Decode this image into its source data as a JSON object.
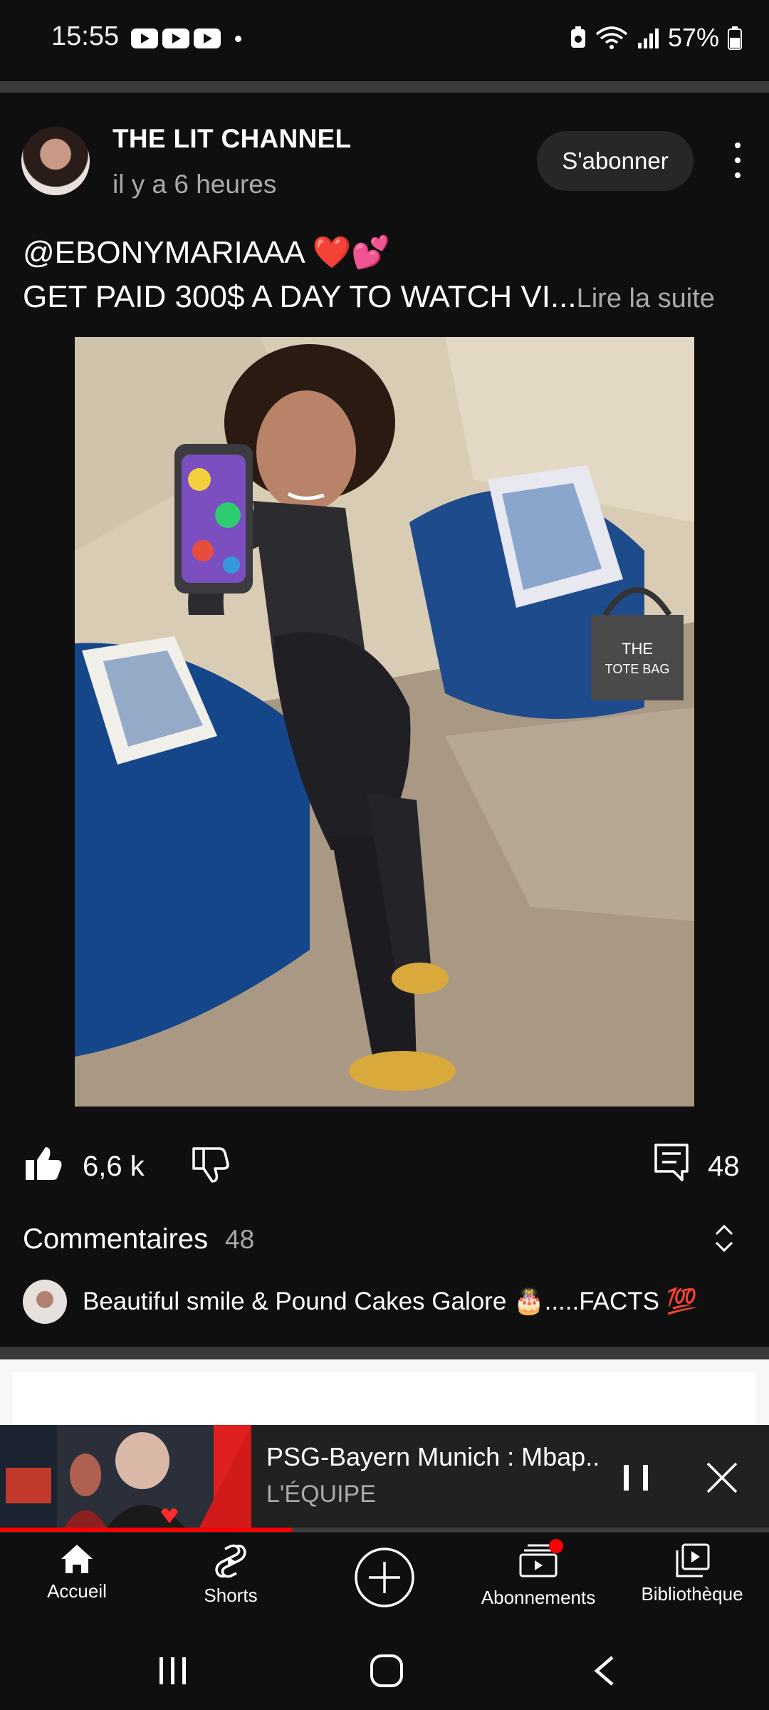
{
  "status_bar": {
    "time": "15:55",
    "battery": "57%",
    "icons": [
      "youtube-notification-icon",
      "youtube-notification-icon",
      "youtube-notification-icon",
      "battery-saver-icon",
      "wifi-icon",
      "signal-icon",
      "battery-icon"
    ]
  },
  "post": {
    "channel_name": "THE LIT CHANNEL",
    "time_ago": "il y a 6 heures",
    "subscribe_label": "S'abonner",
    "text_line1": "@EBONYMARIAAA ❤️💕",
    "text_line2": "GET PAID 300$ A DAY TO WATCH VI...",
    "read_more": "Lire la suite",
    "image_bag_text": "THE TOTE BAG"
  },
  "actions": {
    "like_count": "6,6 k",
    "comment_count": "48"
  },
  "comments": {
    "title": "Commentaires",
    "count": "48",
    "top_comment": "Beautiful smile & Pound Cakes Galore 🎂.....FACTS 💯"
  },
  "mini_player": {
    "title": "PSG-Bayern Munich : Mbap..",
    "channel": "L'ÉQUIPE",
    "progress": 0.38
  },
  "bottom_nav": {
    "items": [
      {
        "label": "Accueil",
        "icon": "home-icon"
      },
      {
        "label": "Shorts",
        "icon": "shorts-icon"
      },
      {
        "label": "",
        "icon": "create-icon"
      },
      {
        "label": "Abonnements",
        "icon": "subscriptions-icon"
      },
      {
        "label": "Bibliothèque",
        "icon": "library-icon"
      }
    ]
  },
  "colors": {
    "background": "#0f0f0f",
    "accent_red": "#ff0000",
    "secondary_text": "#aaaaaa",
    "subscribe_bg": "#272727"
  }
}
